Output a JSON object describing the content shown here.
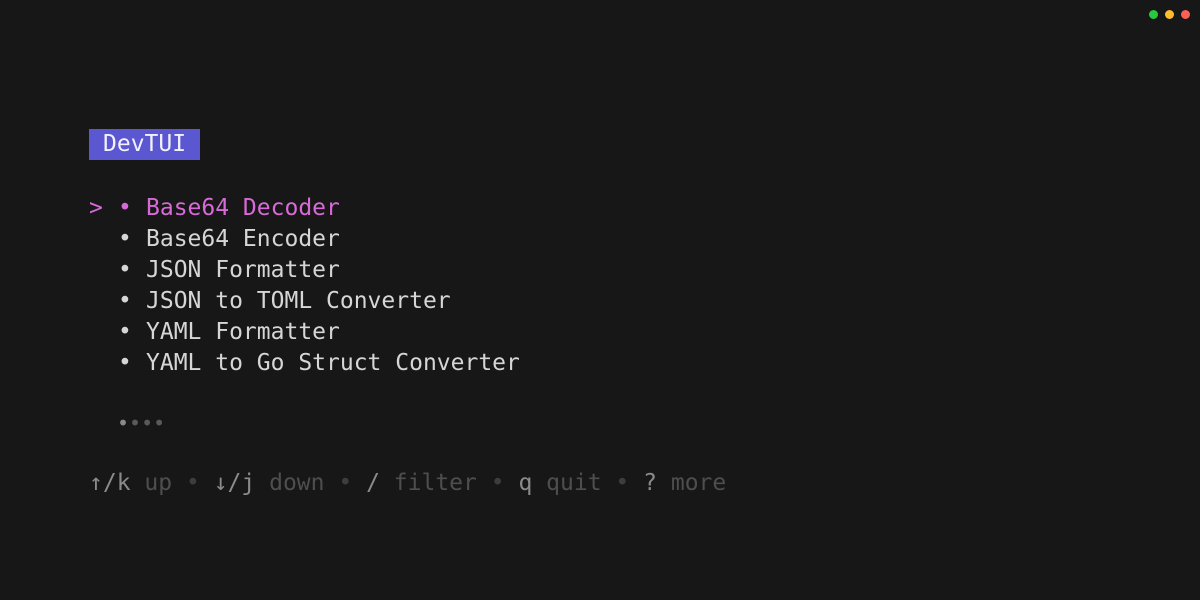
{
  "window": {
    "controls": [
      "green-dot",
      "yellow-dot",
      "red-dot"
    ],
    "colors": {
      "green": "#27c93f",
      "yellow": "#ffbd2e",
      "red": "#ff5f56"
    }
  },
  "app": {
    "title": "DevTUI",
    "title_bg": "#5b57d0"
  },
  "list": {
    "cursor": ">",
    "bullet": "•",
    "items": [
      {
        "label": "Base64 Decoder",
        "selected": true
      },
      {
        "label": "Base64 Encoder",
        "selected": false
      },
      {
        "label": "JSON Formatter",
        "selected": false
      },
      {
        "label": "JSON to TOML Converter",
        "selected": false
      },
      {
        "label": "YAML Formatter",
        "selected": false
      },
      {
        "label": "YAML to Go Struct Converter",
        "selected": false
      }
    ],
    "selected_color": "#d86ad8"
  },
  "pagination": {
    "active": "•",
    "rest": "•••"
  },
  "help": {
    "up_key": "↑/k",
    "up_desc": "up",
    "down_key": "↓/j",
    "down_desc": "down",
    "filter_key": "/",
    "filter_desc": "filter",
    "quit_key": "q",
    "quit_desc": "quit",
    "more_key": "?",
    "more_desc": "more",
    "separator": "•"
  }
}
